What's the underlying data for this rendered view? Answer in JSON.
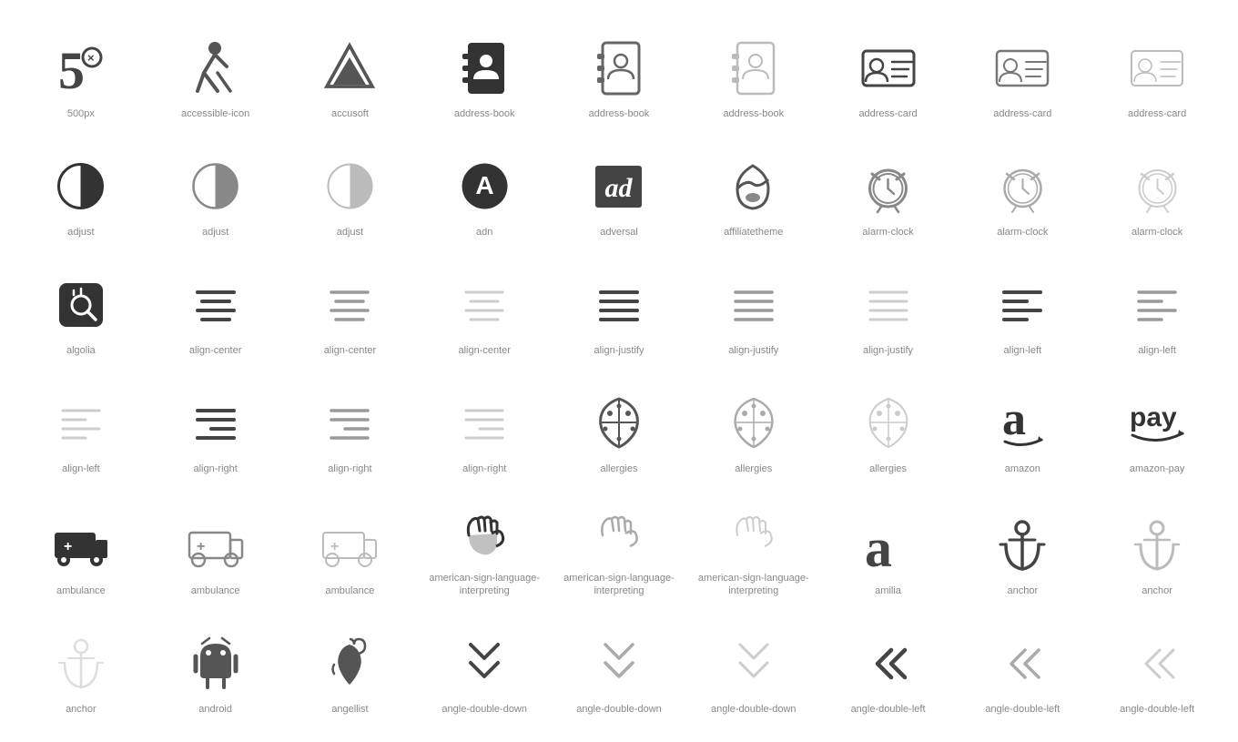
{
  "icons": [
    {
      "name": "500px",
      "row": 1
    },
    {
      "name": "accessible-icon",
      "row": 1
    },
    {
      "name": "accusoft",
      "row": 1
    },
    {
      "name": "address-book",
      "row": 1
    },
    {
      "name": "address-book",
      "row": 1
    },
    {
      "name": "address-book",
      "row": 1
    },
    {
      "name": "address-card",
      "row": 1
    },
    {
      "name": "address-card",
      "row": 1
    },
    {
      "name": "address-card",
      "row": 1
    },
    {
      "name": "adjust",
      "row": 2
    },
    {
      "name": "adjust",
      "row": 2
    },
    {
      "name": "adjust",
      "row": 2
    },
    {
      "name": "adn",
      "row": 2
    },
    {
      "name": "adversal",
      "row": 2
    },
    {
      "name": "affiliatetheme",
      "row": 2
    },
    {
      "name": "alarm-clock",
      "row": 2
    },
    {
      "name": "alarm-clock",
      "row": 2
    },
    {
      "name": "alarm-clock",
      "row": 2
    },
    {
      "name": "algolia",
      "row": 3
    },
    {
      "name": "align-center",
      "row": 3
    },
    {
      "name": "align-center",
      "row": 3
    },
    {
      "name": "align-center",
      "row": 3
    },
    {
      "name": "align-justify",
      "row": 3
    },
    {
      "name": "align-justify",
      "row": 3
    },
    {
      "name": "align-justify",
      "row": 3
    },
    {
      "name": "align-left",
      "row": 3
    },
    {
      "name": "align-left",
      "row": 3
    },
    {
      "name": "align-left",
      "row": 4
    },
    {
      "name": "align-right",
      "row": 4
    },
    {
      "name": "align-right",
      "row": 4
    },
    {
      "name": "align-right",
      "row": 4
    },
    {
      "name": "allergies",
      "row": 4
    },
    {
      "name": "allergies",
      "row": 4
    },
    {
      "name": "allergies",
      "row": 4
    },
    {
      "name": "amazon",
      "row": 4
    },
    {
      "name": "amazon-pay",
      "row": 4
    },
    {
      "name": "ambulance",
      "row": 5
    },
    {
      "name": "ambulance",
      "row": 5
    },
    {
      "name": "ambulance",
      "row": 5
    },
    {
      "name": "american-sign-language-interpreting",
      "row": 5
    },
    {
      "name": "american-sign-language-interpreting",
      "row": 5
    },
    {
      "name": "american-sign-language-interpreting",
      "row": 5
    },
    {
      "name": "amilia",
      "row": 5
    },
    {
      "name": "anchor",
      "row": 5
    },
    {
      "name": "anchor",
      "row": 5
    },
    {
      "name": "anchor",
      "row": 6
    },
    {
      "name": "android",
      "row": 6
    },
    {
      "name": "angellist",
      "row": 6
    },
    {
      "name": "angle-double-down",
      "row": 6
    },
    {
      "name": "angle-double-down",
      "row": 6
    },
    {
      "name": "angle-double-down",
      "row": 6
    },
    {
      "name": "angle-double-left",
      "row": 6
    },
    {
      "name": "angle-double-left",
      "row": 6
    },
    {
      "name": "angle-double-left",
      "row": 6
    }
  ]
}
